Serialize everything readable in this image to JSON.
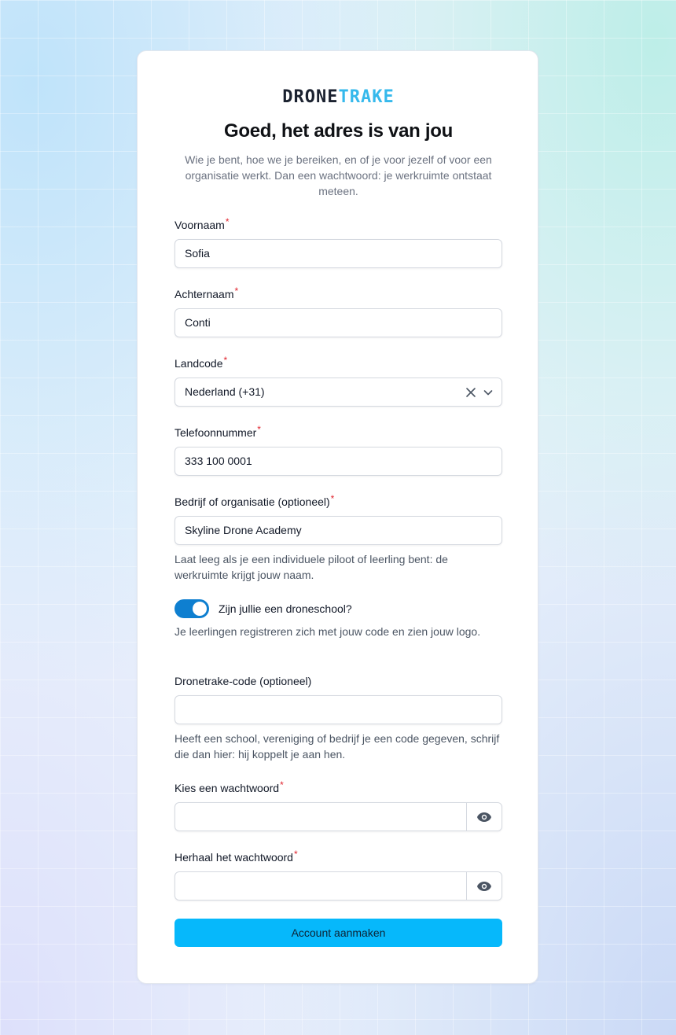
{
  "brand": {
    "part1": "DRONE",
    "part2": "TRAKE"
  },
  "header": {
    "title": "Goed, het adres is van jou",
    "subtitle": "Wie je bent, hoe we je bereiken, en of je voor jezelf of voor een organisatie werkt. Dan een wachtwoord: je werkruimte ontstaat meteen."
  },
  "required_marker": "*",
  "fields": {
    "first_name": {
      "label": "Voornaam",
      "value": "Sofia"
    },
    "last_name": {
      "label": "Achternaam",
      "value": "Conti"
    },
    "country_code": {
      "label": "Landcode",
      "value": "Nederland (+31)"
    },
    "phone": {
      "label": "Telefoonnummer",
      "value": "333 100 0001"
    },
    "company": {
      "label": "Bedrijf of organisatie (optioneel)",
      "value": "Skyline Drone Academy",
      "hint": "Laat leeg als je een individuele piloot of leerling bent: de werkruimte krijgt jouw naam."
    },
    "drone_school": {
      "label": "Zijn jullie een droneschool?",
      "checked": true,
      "hint": "Je leerlingen registreren zich met jouw code en zien jouw logo."
    },
    "code": {
      "label": "Dronetrake-code (optioneel)",
      "value": "",
      "hint": "Heeft een school, vereniging of bedrijf je een code gegeven, schrijf die dan hier: hij koppelt je aan hen."
    },
    "password": {
      "label": "Kies een wachtwoord",
      "value": ""
    },
    "password_repeat": {
      "label": "Herhaal het wachtwoord",
      "value": ""
    }
  },
  "submit_label": "Account aanmaken",
  "colors": {
    "accent": "#06b8fb",
    "toggle": "#0e7fd0",
    "brand_light": "#36b9ec",
    "required": "#e0242e"
  },
  "icons": [
    "clear-icon",
    "chevron-down-icon",
    "eye-icon"
  ]
}
